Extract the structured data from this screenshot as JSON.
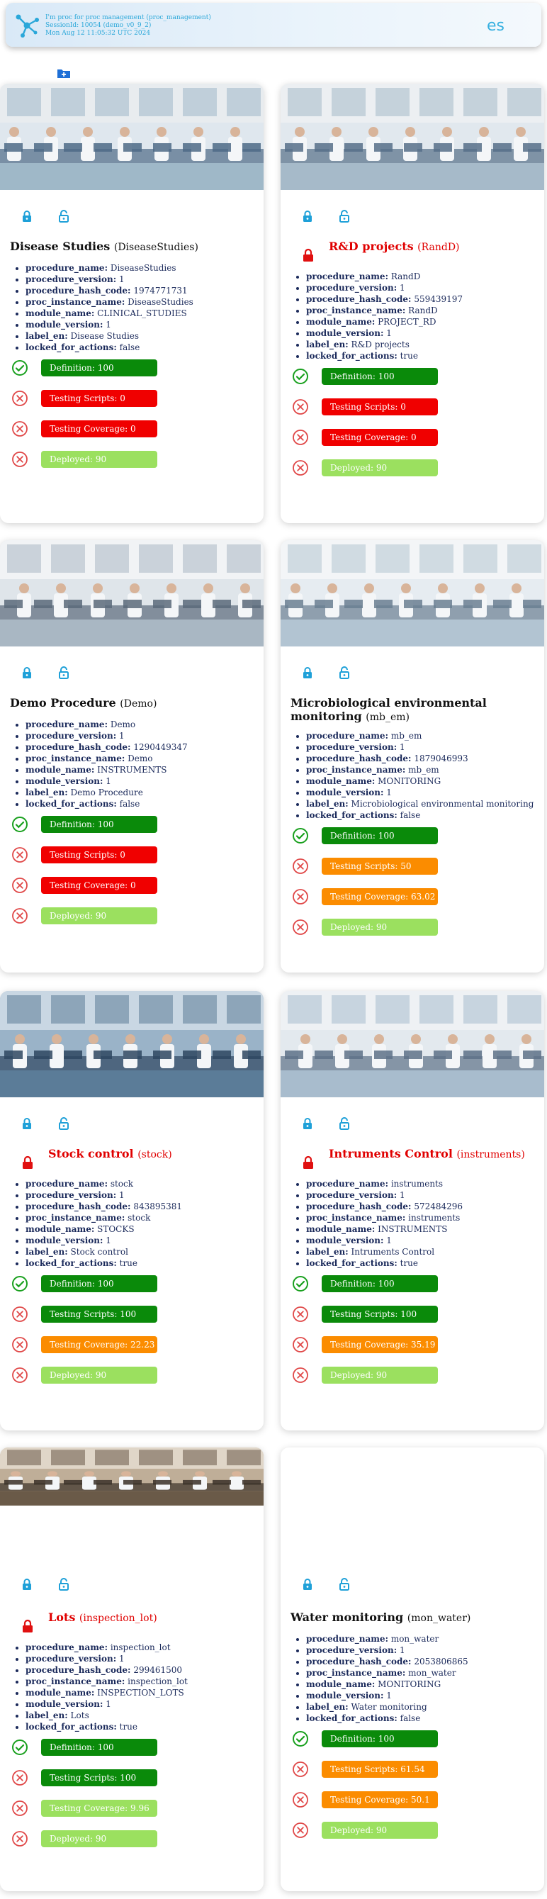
{
  "header": {
    "line1": "I'm proc for proc management (proc_management)",
    "line2": "SessionId: 10054 (demo_v0_9_2)",
    "line3": "Mon Aug 12 11:05:32 UTC 2024",
    "lang": "es"
  },
  "colors": {
    "accent": "#36b0e0",
    "green": "#0a8a0a",
    "red": "#f00000",
    "orange": "#fb8c00",
    "lime": "#9be05f"
  },
  "cards": [
    {
      "title": "Disease Studies",
      "sub": "(DiseaseStudies)",
      "locked": false,
      "props": [
        {
          "k": "procedure_name:",
          "v": "DiseaseStudies"
        },
        {
          "k": "procedure_version:",
          "v": "1"
        },
        {
          "k": "procedure_hash_code:",
          "v": "1974771731"
        },
        {
          "k": "proc_instance_name:",
          "v": "DiseaseStudies"
        },
        {
          "k": "module_name:",
          "v": "CLINICAL_STUDIES"
        },
        {
          "k": "module_version:",
          "v": "1"
        },
        {
          "k": "label_en:",
          "v": "Disease Studies"
        },
        {
          "k": "locked_for_actions:",
          "v": "false"
        }
      ],
      "status": [
        "Definition: 100",
        "Testing Scripts: 0",
        "Testing Coverage: 0",
        "Deployed: 90"
      ]
    },
    {
      "title": "R&D projects",
      "sub": "(RandD)",
      "locked": true,
      "props": [
        {
          "k": "procedure_name:",
          "v": "RandD"
        },
        {
          "k": "procedure_version:",
          "v": "1"
        },
        {
          "k": "procedure_hash_code:",
          "v": "559439197"
        },
        {
          "k": "proc_instance_name:",
          "v": "RandD"
        },
        {
          "k": "module_name:",
          "v": "PROJECT_RD"
        },
        {
          "k": "module_version:",
          "v": "1"
        },
        {
          "k": "label_en:",
          "v": "R&D projects"
        },
        {
          "k": "locked_for_actions:",
          "v": "true"
        }
      ],
      "status": [
        "Definition: 100",
        "Testing Scripts: 0",
        "Testing Coverage: 0",
        "Deployed: 90"
      ]
    },
    {
      "title": "Demo Procedure",
      "sub": "(Demo)",
      "locked": false,
      "props": [
        {
          "k": "procedure_name:",
          "v": "Demo"
        },
        {
          "k": "procedure_version:",
          "v": "1"
        },
        {
          "k": "procedure_hash_code:",
          "v": "1290449347"
        },
        {
          "k": "proc_instance_name:",
          "v": "Demo"
        },
        {
          "k": "module_name:",
          "v": "INSTRUMENTS"
        },
        {
          "k": "module_version:",
          "v": "1"
        },
        {
          "k": "label_en:",
          "v": "Demo Procedure"
        },
        {
          "k": "locked_for_actions:",
          "v": "false"
        }
      ],
      "status": [
        "Definition: 100",
        "Testing Scripts: 0",
        "Testing Coverage: 0",
        "Deployed: 90"
      ]
    },
    {
      "title": "Microbiological environmental monitoring",
      "sub": "(mb_em)",
      "locked": false,
      "props": [
        {
          "k": "procedure_name:",
          "v": "mb_em"
        },
        {
          "k": "procedure_version:",
          "v": "1"
        },
        {
          "k": "procedure_hash_code:",
          "v": "1879046993"
        },
        {
          "k": "proc_instance_name:",
          "v": "mb_em"
        },
        {
          "k": "module_name:",
          "v": "MONITORING"
        },
        {
          "k": "module_version:",
          "v": "1"
        },
        {
          "k": "label_en:",
          "v": "Microbiological environmental monitoring"
        },
        {
          "k": "locked_for_actions:",
          "v": "false"
        }
      ],
      "status": [
        "Definition: 100",
        "Testing Scripts: 50",
        "Testing Coverage: 63.02",
        "Deployed: 90"
      ]
    },
    {
      "title": "Stock control",
      "sub": "(stock)",
      "locked": true,
      "props": [
        {
          "k": "procedure_name:",
          "v": "stock"
        },
        {
          "k": "procedure_version:",
          "v": "1"
        },
        {
          "k": "procedure_hash_code:",
          "v": "843895381"
        },
        {
          "k": "proc_instance_name:",
          "v": "stock"
        },
        {
          "k": "module_name:",
          "v": "STOCKS"
        },
        {
          "k": "module_version:",
          "v": "1"
        },
        {
          "k": "label_en:",
          "v": "Stock control"
        },
        {
          "k": "locked_for_actions:",
          "v": "true"
        }
      ],
      "status": [
        "Definition: 100",
        "Testing Scripts: 100",
        "Testing Coverage: 22.23",
        "Deployed: 90"
      ]
    },
    {
      "title": "Intruments Control",
      "sub": "(instruments)",
      "locked": true,
      "props": [
        {
          "k": "procedure_name:",
          "v": "instruments"
        },
        {
          "k": "procedure_version:",
          "v": "1"
        },
        {
          "k": "procedure_hash_code:",
          "v": "572484296"
        },
        {
          "k": "proc_instance_name:",
          "v": "instruments"
        },
        {
          "k": "module_name:",
          "v": "INSTRUMENTS"
        },
        {
          "k": "module_version:",
          "v": "1"
        },
        {
          "k": "label_en:",
          "v": "Intruments Control"
        },
        {
          "k": "locked_for_actions:",
          "v": "true"
        }
      ],
      "status": [
        "Definition: 100",
        "Testing Scripts: 100",
        "Testing Coverage: 35.19",
        "Deployed: 90"
      ]
    },
    {
      "title": "Lots",
      "sub": "(inspection_lot)",
      "locked": true,
      "props": [
        {
          "k": "procedure_name:",
          "v": "inspection_lot"
        },
        {
          "k": "procedure_version:",
          "v": "1"
        },
        {
          "k": "procedure_hash_code:",
          "v": "299461500"
        },
        {
          "k": "proc_instance_name:",
          "v": "inspection_lot"
        },
        {
          "k": "module_name:",
          "v": "INSPECTION_LOTS"
        },
        {
          "k": "module_version:",
          "v": "1"
        },
        {
          "k": "label_en:",
          "v": "Lots"
        },
        {
          "k": "locked_for_actions:",
          "v": "true"
        }
      ],
      "status": [
        "Definition: 100",
        "Testing Scripts: 100",
        "Testing Coverage: 9.96",
        "Deployed: 90"
      ]
    },
    {
      "title": "Water monitoring",
      "sub": "(mon_water)",
      "locked": false,
      "props": [
        {
          "k": "procedure_name:",
          "v": "mon_water"
        },
        {
          "k": "procedure_version:",
          "v": "1"
        },
        {
          "k": "procedure_hash_code:",
          "v": "2053806865"
        },
        {
          "k": "proc_instance_name:",
          "v": "mon_water"
        },
        {
          "k": "module_name:",
          "v": "MONITORING"
        },
        {
          "k": "module_version:",
          "v": "1"
        },
        {
          "k": "label_en:",
          "v": "Water monitoring"
        },
        {
          "k": "locked_for_actions:",
          "v": "false"
        }
      ],
      "status": [
        "Definition: 100",
        "Testing Scripts: 61.54",
        "Testing Coverage: 50.1",
        "Deployed: 90"
      ]
    }
  ]
}
